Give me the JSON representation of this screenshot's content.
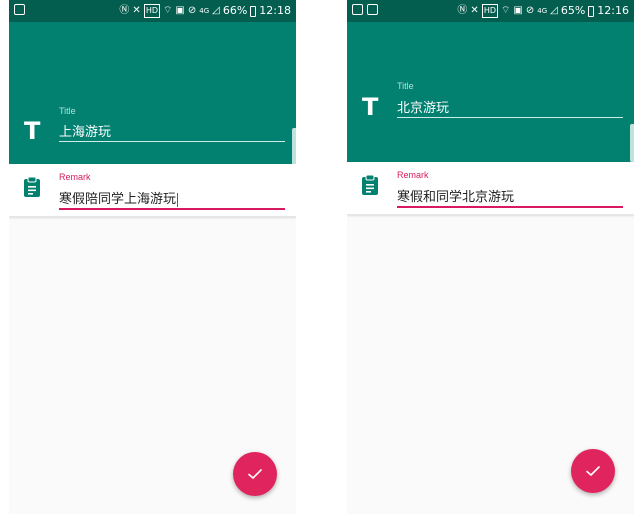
{
  "screens": [
    {
      "status_bar": {
        "battery": "66%",
        "time": "12:18",
        "network": "4G",
        "hd_badge": "HD"
      },
      "title_field": {
        "label": "Title",
        "value": "上海游玩"
      },
      "remark_field": {
        "label": "Remark",
        "value": "寒假陪同学上海游玩"
      },
      "fab_icon": "check-icon"
    },
    {
      "status_bar": {
        "battery": "65%",
        "time": "12:16",
        "network": "4G",
        "hd_badge": "HD"
      },
      "title_field": {
        "label": "Title",
        "value": "北京游玩"
      },
      "remark_field": {
        "label": "Remark",
        "value": "寒假和同学北京游玩"
      },
      "fab_icon": "check-icon"
    }
  ],
  "colors": {
    "status_bar": "#045e4f",
    "primary": "#028070",
    "accent": "#d81b60",
    "fab": "#e0245e",
    "background": "#fafafa"
  }
}
